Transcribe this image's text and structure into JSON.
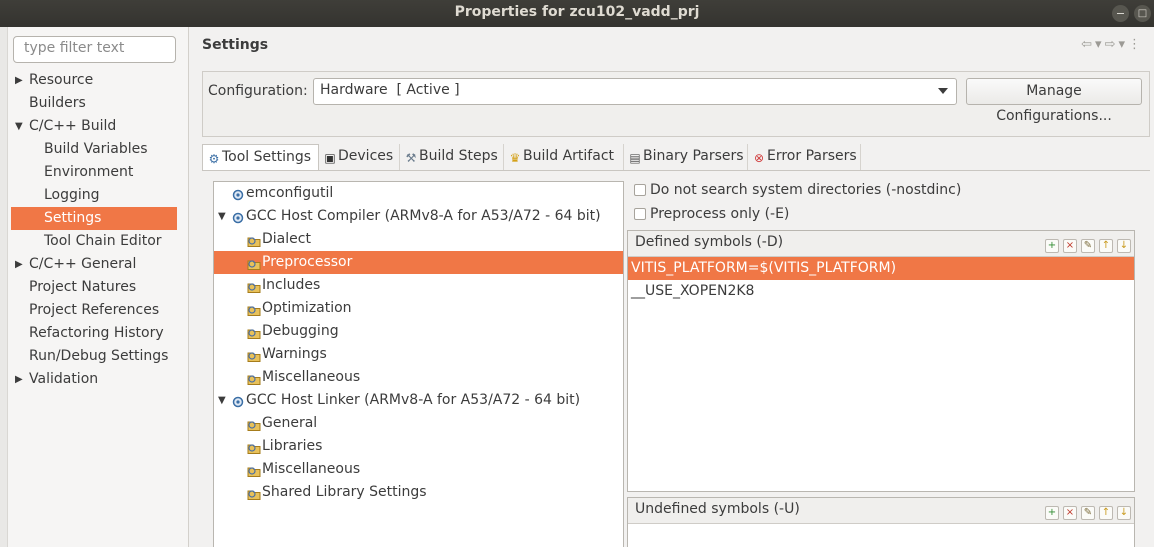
{
  "window": {
    "title": "Properties for zcu102_vadd_prj"
  },
  "filter": {
    "placeholder": "type filter text"
  },
  "nav_tree": [
    {
      "label": "Resource",
      "arrow": "▶",
      "depth": 0
    },
    {
      "label": "Builders",
      "arrow": "",
      "depth": 0
    },
    {
      "label": "C/C++ Build",
      "arrow": "▼",
      "depth": 0
    },
    {
      "label": "Build Variables",
      "arrow": "",
      "depth": 1
    },
    {
      "label": "Environment",
      "arrow": "",
      "depth": 1
    },
    {
      "label": "Logging",
      "arrow": "",
      "depth": 1
    },
    {
      "label": "Settings",
      "arrow": "",
      "depth": 1,
      "selected": true
    },
    {
      "label": "Tool Chain Editor",
      "arrow": "",
      "depth": 1
    },
    {
      "label": "C/C++ General",
      "arrow": "▶",
      "depth": 0
    },
    {
      "label": "Project Natures",
      "arrow": "",
      "depth": 0
    },
    {
      "label": "Project References",
      "arrow": "",
      "depth": 0
    },
    {
      "label": "Refactoring History",
      "arrow": "",
      "depth": 0
    },
    {
      "label": "Run/Debug Settings",
      "arrow": "",
      "depth": 0
    },
    {
      "label": "Validation",
      "arrow": "▶",
      "depth": 0
    }
  ],
  "page": {
    "title": "Settings"
  },
  "configuration": {
    "label": "Configuration:",
    "value": "Hardware  [ Active ]",
    "manage_label": "Manage Configurations..."
  },
  "tabs": [
    {
      "label": "Tool Settings",
      "icon": "tool-settings-icon",
      "active": true
    },
    {
      "label": "Devices",
      "icon": "devices-icon"
    },
    {
      "label": "Build Steps",
      "icon": "build-steps-icon"
    },
    {
      "label": "Build Artifact",
      "icon": "build-artifact-icon"
    },
    {
      "label": "Binary Parsers",
      "icon": "binary-parsers-icon"
    },
    {
      "label": "Error Parsers",
      "icon": "error-parsers-icon"
    }
  ],
  "tool_tree": [
    {
      "label": "emconfigutil",
      "depth": 0,
      "arrow": ""
    },
    {
      "label": "GCC Host Compiler (ARMv8-A for A53/A72 - 64 bit)",
      "depth": 0,
      "arrow": "▼"
    },
    {
      "label": "Dialect",
      "depth": 1
    },
    {
      "label": "Preprocessor",
      "depth": 1,
      "selected": true
    },
    {
      "label": "Includes",
      "depth": 1
    },
    {
      "label": "Optimization",
      "depth": 1
    },
    {
      "label": "Debugging",
      "depth": 1
    },
    {
      "label": "Warnings",
      "depth": 1
    },
    {
      "label": "Miscellaneous",
      "depth": 1
    },
    {
      "label": "GCC Host Linker (ARMv8-A for A53/A72 - 64 bit)",
      "depth": 0,
      "arrow": "▼"
    },
    {
      "label": "General",
      "depth": 1
    },
    {
      "label": "Libraries",
      "depth": 1
    },
    {
      "label": "Miscellaneous",
      "depth": 1
    },
    {
      "label": "Shared Library Settings",
      "depth": 1
    }
  ],
  "options": {
    "nostdinc_label": "Do not search system directories (-nostdinc)",
    "preprocess_only_label": "Preprocess only (-E)"
  },
  "defined_symbols": {
    "label": "Defined symbols (-D)",
    "items": [
      "VITIS_PLATFORM=$(VITIS_PLATFORM)",
      "__USE_XOPEN2K8"
    ]
  },
  "undefined_symbols": {
    "label": "Undefined symbols (-U)",
    "items": []
  },
  "colors": {
    "selection": "#f07746",
    "titlebar": "#3c3b37"
  }
}
